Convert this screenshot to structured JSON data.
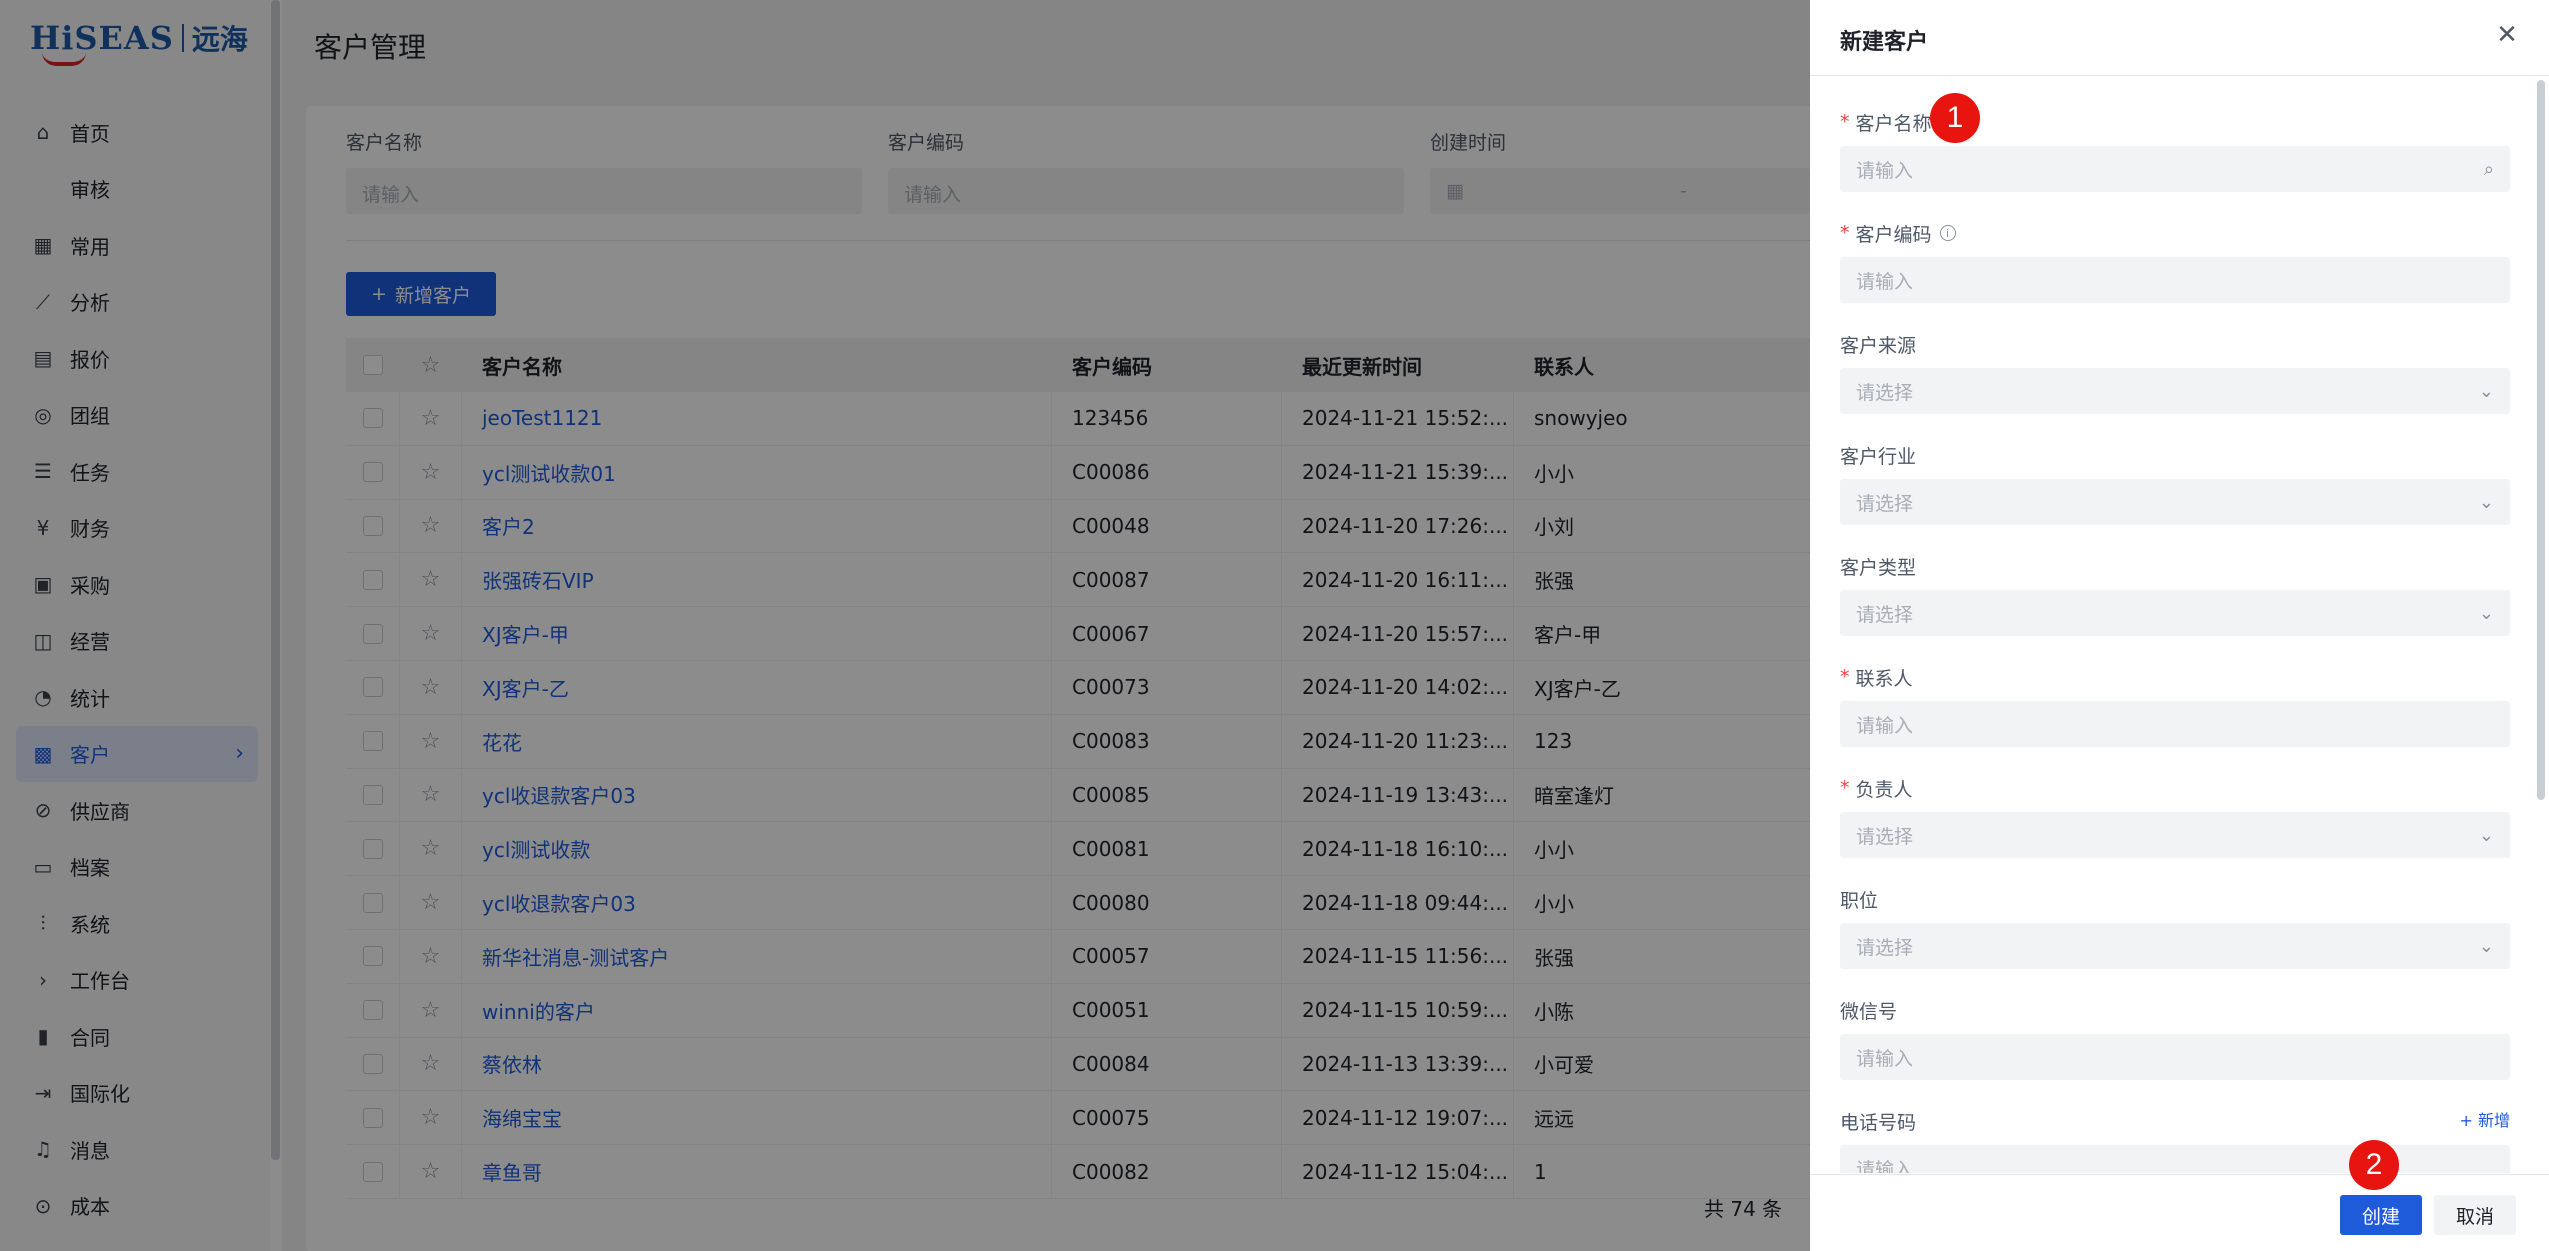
{
  "brand": {
    "name": "HiSEAS",
    "cn": "远海"
  },
  "sidebar": {
    "items": [
      {
        "label": "首页",
        "icon": "home-icon"
      },
      {
        "label": "审核",
        "icon": ""
      },
      {
        "label": "常用",
        "icon": "grid-icon"
      },
      {
        "label": "分析",
        "icon": "analysis-icon"
      },
      {
        "label": "报价",
        "icon": "quote-icon"
      },
      {
        "label": "团组",
        "icon": "group-icon"
      },
      {
        "label": "任务",
        "icon": "task-icon"
      },
      {
        "label": "财务",
        "icon": "finance-icon"
      },
      {
        "label": "采购",
        "icon": "purchase-icon"
      },
      {
        "label": "经营",
        "icon": "business-icon"
      },
      {
        "label": "统计",
        "icon": "stats-icon"
      },
      {
        "label": "客户",
        "icon": "customer-icon",
        "active": true
      },
      {
        "label": "供应商",
        "icon": "supplier-icon"
      },
      {
        "label": "档案",
        "icon": "archive-icon"
      },
      {
        "label": "系统",
        "icon": "settings-icon"
      },
      {
        "label": "工作台",
        "icon": "chevron-right-icon"
      },
      {
        "label": "合同",
        "icon": "contract-icon"
      },
      {
        "label": "国际化",
        "icon": "i18n-icon"
      },
      {
        "label": "消息",
        "icon": "bell-icon"
      },
      {
        "label": "成本",
        "icon": "cost-icon"
      }
    ]
  },
  "main": {
    "title": "客户管理",
    "filters": {
      "name_label": "客户名称",
      "name_placeholder": "请输入",
      "code_label": "客户编码",
      "code_placeholder": "请输入",
      "time_label": "创建时间",
      "time_sep": "-"
    },
    "add_button": "新增客户",
    "table": {
      "headers": [
        "客户名称",
        "客户编码",
        "最近更新时间",
        "联系人"
      ],
      "rows": [
        {
          "name": "jeoTest1121",
          "code": "123456",
          "time": "2024-11-21 15:52:...",
          "contact": "snowyjeo"
        },
        {
          "name": "ycl测试收款01",
          "code": "C00086",
          "time": "2024-11-21 15:39:...",
          "contact": "小小"
        },
        {
          "name": "客户2",
          "code": "C00048",
          "time": "2024-11-20 17:26:...",
          "contact": "小刘"
        },
        {
          "name": "张强砖石VIP",
          "code": "C00087",
          "time": "2024-11-20 16:11:...",
          "contact": "张强"
        },
        {
          "name": "XJ客户-甲",
          "code": "C00067",
          "time": "2024-11-20 15:57:...",
          "contact": "客户-甲"
        },
        {
          "name": "XJ客户-乙",
          "code": "C00073",
          "time": "2024-11-20 14:02:...",
          "contact": "XJ客户-乙"
        },
        {
          "name": "花花",
          "code": "C00083",
          "time": "2024-11-20 11:23:...",
          "contact": "123"
        },
        {
          "name": "ycl收退款客户03",
          "code": "C00085",
          "time": "2024-11-19 13:43:...",
          "contact": "暗室逢灯"
        },
        {
          "name": "ycl测试收款",
          "code": "C00081",
          "time": "2024-11-18 16:10:...",
          "contact": "小小"
        },
        {
          "name": "ycl收退款客户03",
          "code": "C00080",
          "time": "2024-11-18 09:44:...",
          "contact": "小小"
        },
        {
          "name": "新华社消息-测试客户",
          "code": "C00057",
          "time": "2024-11-15 11:56:...",
          "contact": "张强"
        },
        {
          "name": "winni的客户",
          "code": "C00051",
          "time": "2024-11-15 10:59:...",
          "contact": "小陈"
        },
        {
          "name": "蔡依林",
          "code": "C00084",
          "time": "2024-11-13 13:39:...",
          "contact": "小可爱"
        },
        {
          "name": "海绵宝宝",
          "code": "C00075",
          "time": "2024-11-12 19:07:...",
          "contact": "远远"
        },
        {
          "name": "章鱼哥",
          "code": "C00082",
          "time": "2024-11-12 15:04:...",
          "contact": "1"
        }
      ]
    },
    "total": "共 74 条"
  },
  "drawer": {
    "title": "新建客户",
    "fields": [
      {
        "label": "客户名称",
        "required": true,
        "placeholder": "请输入",
        "type": "search"
      },
      {
        "label": "客户编码",
        "required": true,
        "placeholder": "请输入",
        "type": "input",
        "info": true
      },
      {
        "label": "客户来源",
        "required": false,
        "placeholder": "请选择",
        "type": "select"
      },
      {
        "label": "客户行业",
        "required": false,
        "placeholder": "请选择",
        "type": "select"
      },
      {
        "label": "客户类型",
        "required": false,
        "placeholder": "请选择",
        "type": "select"
      },
      {
        "label": "联系人",
        "required": true,
        "placeholder": "请输入",
        "type": "input"
      },
      {
        "label": "负责人",
        "required": true,
        "placeholder": "请选择",
        "type": "select"
      },
      {
        "label": "职位",
        "required": false,
        "placeholder": "请选择",
        "type": "select"
      },
      {
        "label": "微信号",
        "required": false,
        "placeholder": "请输入",
        "type": "input"
      },
      {
        "label": "电话号码",
        "required": false,
        "placeholder": "请输入",
        "type": "input"
      }
    ],
    "add_phone": "新增",
    "create_button": "创建",
    "cancel_button": "取消"
  },
  "badges": [
    "1",
    "2"
  ],
  "colors": {
    "primary": "#1e5bdb",
    "badge": "#e8140f",
    "required": "#f53f3f"
  }
}
